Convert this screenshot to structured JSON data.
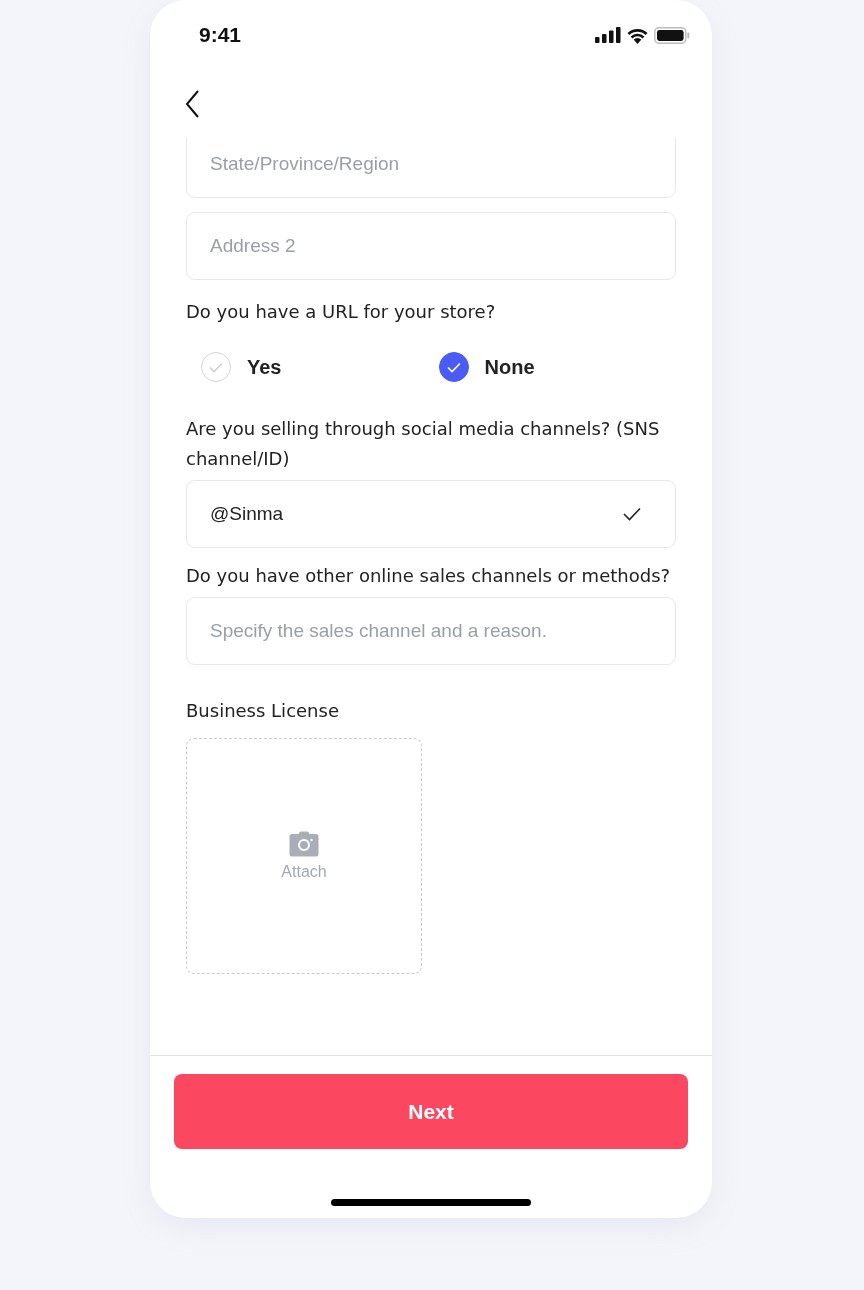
{
  "status_bar": {
    "time": "9:41"
  },
  "form": [
    {
      "kind": "field",
      "placeholder": "State/Province/Region"
    },
    {
      "kind": "field",
      "placeholder": "Address 2"
    },
    {
      "kind": "choice",
      "label": "Do you have a URL for your store?",
      "options": [
        {
          "label": "Yes",
          "selected": false
        },
        {
          "label": "None",
          "selected": true
        }
      ]
    },
    {
      "kind": "text",
      "label": "Are you selling through social media channels? (SNS channel/ID)",
      "value": "@Sinma",
      "verified": true
    },
    {
      "kind": "text",
      "label": "Do you have other online sales channels or methods?",
      "placeholder": "Specify the sales channel and a reason."
    },
    {
      "kind": "upload",
      "label": "Business License",
      "action": "Attach"
    }
  ],
  "next_button": "Next"
}
